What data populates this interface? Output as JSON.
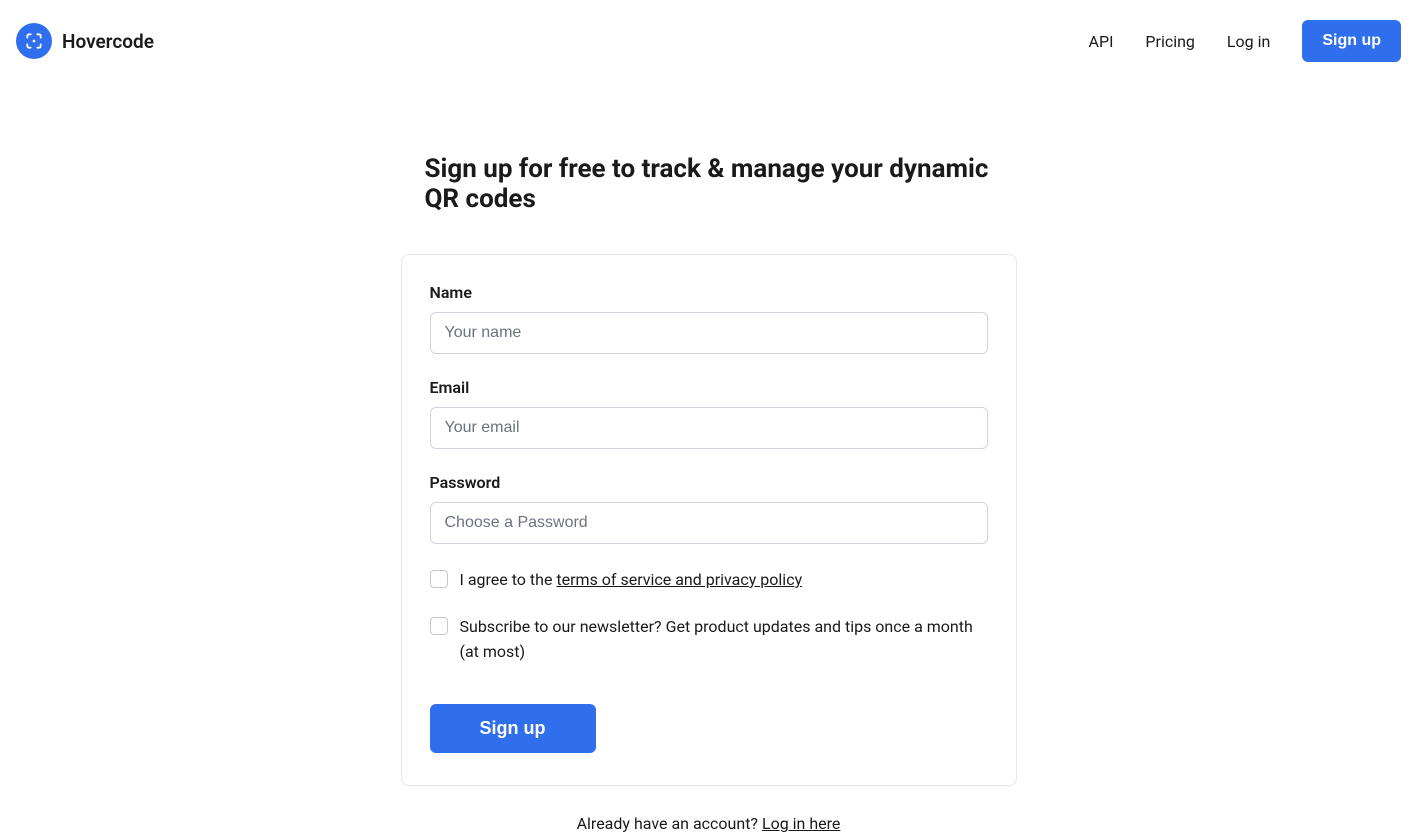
{
  "brand": {
    "name": "Hovercode"
  },
  "nav": {
    "api": "API",
    "pricing": "Pricing",
    "login": "Log in",
    "signup": "Sign up"
  },
  "page": {
    "title": "Sign up for free to track & manage your dynamic QR codes"
  },
  "form": {
    "name_label": "Name",
    "name_placeholder": "Your name",
    "email_label": "Email",
    "email_placeholder": "Your email",
    "password_label": "Password",
    "password_placeholder": "Choose a Password",
    "terms_prefix": "I agree to the ",
    "terms_link": "terms of service and privacy policy",
    "newsletter_label": "Subscribe to our newsletter? Get product updates and tips once a month (at most)",
    "submit": "Sign up"
  },
  "footer": {
    "already_prefix": "Already have an account? ",
    "login_link": "Log in here"
  }
}
